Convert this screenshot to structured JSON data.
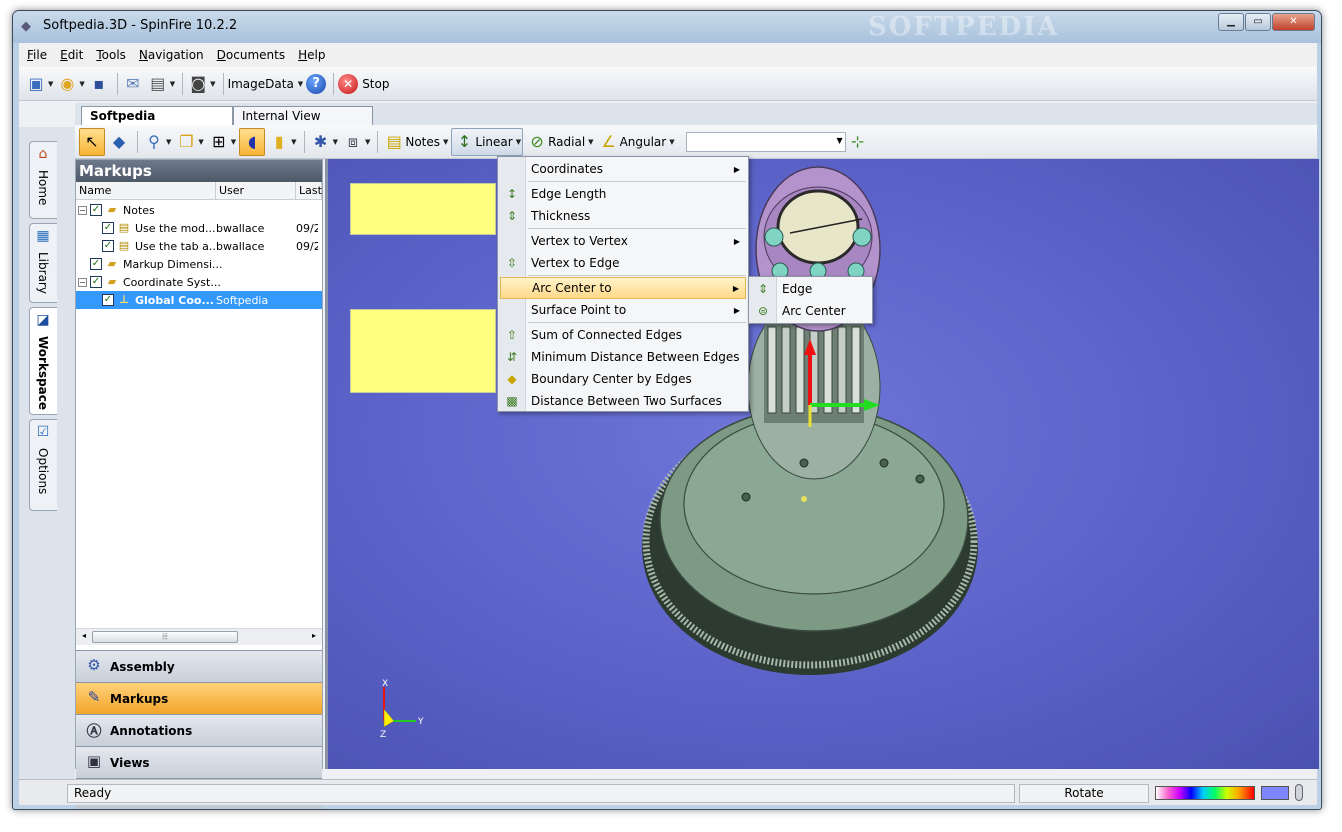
{
  "window": {
    "title": "Softpedia.3D - SpinFire 10.2.2",
    "watermark": "SOFTPEDIA"
  },
  "menu": [
    "File",
    "Edit",
    "Tools",
    "Navigation",
    "Documents",
    "Help"
  ],
  "toolbar1": {
    "imagedata_label": "ImageData",
    "stop_label": "Stop"
  },
  "doc_tabs": [
    {
      "label": "Softpedia",
      "active": true
    },
    {
      "label": "Internal View",
      "active": false
    }
  ],
  "toolbar2": {
    "notes_label": "Notes",
    "linear_label": "Linear",
    "radial_label": "Radial",
    "angular_label": "Angular",
    "combo_value": ""
  },
  "side_tabs": [
    {
      "label": "Home",
      "icon": "home-icon"
    },
    {
      "label": "Library",
      "icon": "library-icon"
    },
    {
      "label": "Workspace",
      "icon": "workspace-icon",
      "active": true
    },
    {
      "label": "Options",
      "icon": "options-icon"
    }
  ],
  "panel": {
    "title": "Markups",
    "columns": [
      "Name",
      "User",
      "Last"
    ],
    "rows": [
      {
        "name": "Notes",
        "user": "",
        "last": "",
        "level": 0,
        "expand": "−",
        "icon": "folder-icon",
        "selected": false
      },
      {
        "name": "Use the mod...",
        "user": "bwallace",
        "last": "09/2",
        "level": 1,
        "expand": "",
        "icon": "note-icon",
        "selected": false
      },
      {
        "name": "Use the tab a...",
        "user": "bwallace",
        "last": "09/2",
        "level": 1,
        "expand": "",
        "icon": "note-icon",
        "selected": false
      },
      {
        "name": "Markup Dimensi...",
        "user": "",
        "last": "",
        "level": 0,
        "expand": "",
        "icon": "folder-icon",
        "selected": false
      },
      {
        "name": "Coordinate Syst...",
        "user": "",
        "last": "",
        "level": 0,
        "expand": "−",
        "icon": "coordinate-folder-icon",
        "selected": false
      },
      {
        "name": "Global Coo...",
        "user": "Softpedia",
        "last": "",
        "level": 1,
        "expand": "",
        "icon": "axis-icon",
        "selected": true
      }
    ],
    "nav_buttons": [
      {
        "label": "Assembly",
        "icon": "assembly-icon",
        "active": false
      },
      {
        "label": "Markups",
        "icon": "markups-icon",
        "active": true
      },
      {
        "label": "Annotations",
        "icon": "annotations-icon",
        "active": false
      },
      {
        "label": "Views",
        "icon": "views-icon",
        "active": false
      }
    ]
  },
  "linear_menu": [
    {
      "label": "Coordinates",
      "submenu": true,
      "icon": ""
    },
    {
      "separator": true
    },
    {
      "label": "Edge Length",
      "submenu": false,
      "icon": "edge-length-icon"
    },
    {
      "label": "Thickness",
      "submenu": false,
      "icon": "thickness-icon"
    },
    {
      "separator": true
    },
    {
      "label": "Vertex to Vertex",
      "submenu": true,
      "icon": ""
    },
    {
      "label": "Vertex to Edge",
      "submenu": false,
      "icon": "vertex-edge-icon"
    },
    {
      "separator": true
    },
    {
      "label": "Arc Center to",
      "submenu": true,
      "icon": "",
      "highlighted": true
    },
    {
      "label": "Surface Point to",
      "submenu": true,
      "icon": ""
    },
    {
      "separator": true
    },
    {
      "label": "Sum of Connected Edges",
      "submenu": false,
      "icon": "sum-edges-icon"
    },
    {
      "label": "Minimum Distance Between Edges",
      "submenu": false,
      "icon": "min-distance-icon"
    },
    {
      "label": "Boundary Center by Edges",
      "submenu": false,
      "icon": "boundary-center-icon"
    },
    {
      "label": "Distance Between Two Surfaces",
      "submenu": false,
      "icon": "surfaces-distance-icon"
    }
  ],
  "arc_submenu": [
    {
      "label": "Edge",
      "icon": "arc-edge-icon"
    },
    {
      "label": "Arc Center",
      "icon": "arc-center-icon"
    }
  ],
  "viewport": {
    "axis_labels": [
      "X",
      "Y",
      "Z"
    ],
    "gizmo_labels": [
      "X",
      "Y",
      "Z"
    ]
  },
  "status": {
    "ready": "Ready",
    "mode": "Rotate"
  },
  "colors": {
    "viewport_bg": "#5a62c8",
    "note_yellow": "#ffff80",
    "active_orange": "#f2a52a",
    "selection_blue": "#3399ff"
  }
}
